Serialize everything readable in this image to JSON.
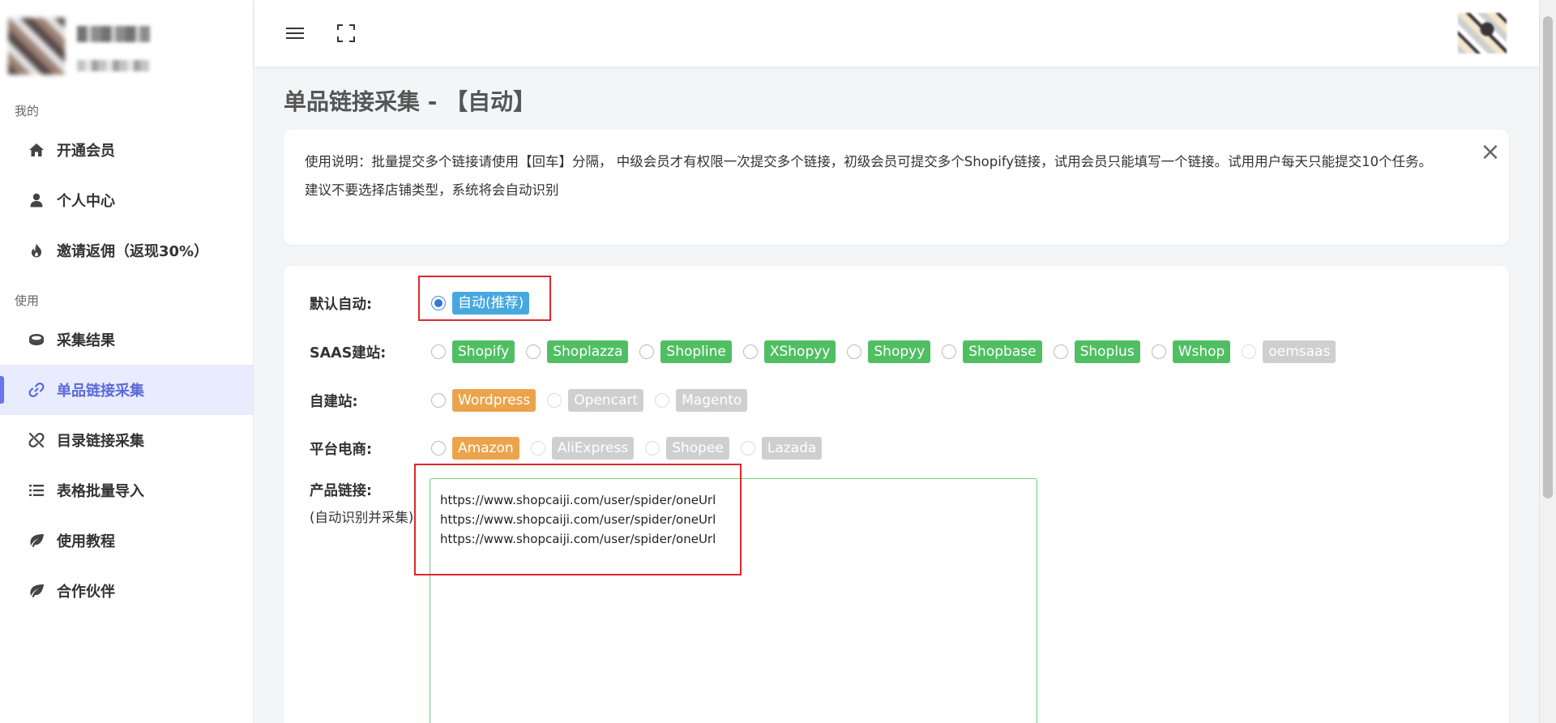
{
  "sidebar": {
    "section_mine": "我的",
    "section_use": "使用",
    "items": [
      {
        "label": "开通会员",
        "icon": "home-icon"
      },
      {
        "label": "个人中心",
        "icon": "user-icon"
      },
      {
        "label": "邀请返佣（返现30%）",
        "icon": "fire-icon"
      },
      {
        "label": "采集结果",
        "icon": "database-icon"
      },
      {
        "label": "单品链接采集",
        "icon": "link-icon"
      },
      {
        "label": "目录链接采集",
        "icon": "unlink-icon"
      },
      {
        "label": "表格批量导入",
        "icon": "list-icon"
      },
      {
        "label": "使用教程",
        "icon": "leaf-icon"
      },
      {
        "label": "合作伙伴",
        "icon": "leaf-icon"
      }
    ],
    "active_item": "单品链接采集"
  },
  "topbar": {
    "menu_icon": "hamburger-icon",
    "fullscreen_icon": "fullscreen-icon"
  },
  "page": {
    "title": "单品链接采集 - 【自动】"
  },
  "notice": {
    "line1": "使用说明：批量提交多个链接请使用【回车】分隔， 中级会员才有权限一次提交多个链接，初级会员可提交多个Shopify链接，试用会员只能填写一个链接。试用用户每天只能提交10个任务。",
    "line2": "建议不要选择店铺类型，系统将会自动识别",
    "close": "×"
  },
  "form": {
    "default_label": "默认自动:",
    "default_option": "自动(推荐)",
    "saas_label": "SAAS建站:",
    "saas_options": [
      "Shopify",
      "Shoplazza",
      "Shopline",
      "XShopyy",
      "Shopyy",
      "Shopbase",
      "Shoplus",
      "Wshop",
      "oemsaas"
    ],
    "self_label": "自建站:",
    "self_options": [
      "Wordpress",
      "Opencart",
      "Magento"
    ],
    "platform_label": "平台电商:",
    "platform_options": [
      "Amazon",
      "AliExpress",
      "Shopee",
      "Lazada"
    ],
    "product_label": "产品链接:",
    "product_sublabel": "(自动识别并采集)",
    "links_value": "https://www.shopcaiji.com/user/spider/oneUrl\nhttps://www.shopcaiji.com/user/spider/oneUrl\nhttps://www.shopcaiji.com/user/spider/oneUrl"
  },
  "colors": {
    "accent": "#6a74ee",
    "tag_blue": "#47a8df",
    "tag_green": "#50bf63",
    "tag_orange": "#eba44c",
    "tag_gray": "#cfcfcf",
    "highlight_red": "#e0262b"
  }
}
